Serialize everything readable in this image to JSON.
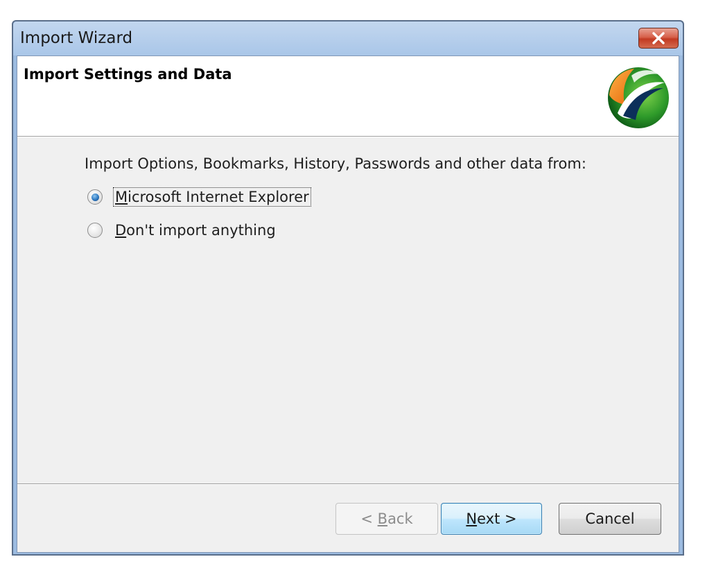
{
  "window": {
    "title": "Import Wizard"
  },
  "header": {
    "title": "Import Settings and Data",
    "logo_icon": "browser-logo-icon"
  },
  "content": {
    "prompt": "Import Options, Bookmarks, History, Passwords and other data from:",
    "options": [
      {
        "mnemonic": "M",
        "rest": "icrosoft Internet Explorer",
        "selected": true
      },
      {
        "mnemonic": "D",
        "rest": "on't import anything",
        "selected": false
      }
    ]
  },
  "buttons": {
    "back": {
      "prefix": "< ",
      "mnemonic": "B",
      "rest": "ack",
      "enabled": false
    },
    "next": {
      "mnemonic": "N",
      "rest": "ext >",
      "enabled": true
    },
    "cancel": {
      "label": "Cancel",
      "enabled": true
    }
  },
  "colors": {
    "titlebar": "#a9c6e8",
    "close_button": "#c23a22",
    "client_bg": "#f0f0f0",
    "default_button_border": "#3c7fb1",
    "radio_dot": "#2d78c0"
  }
}
